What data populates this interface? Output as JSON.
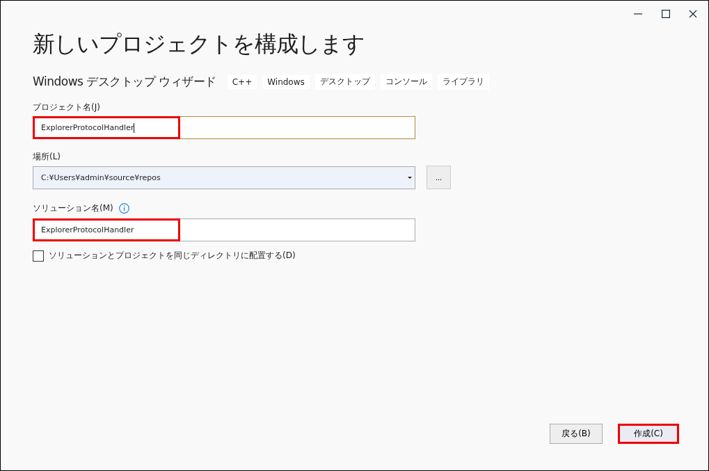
{
  "window": {
    "title": "新しいプロジェクトを構成します"
  },
  "template": {
    "name": "Windows デスクトップ ウィザード",
    "tags": [
      "C++",
      "Windows",
      "デスクトップ",
      "コンソール",
      "ライブラリ"
    ]
  },
  "project_name": {
    "label": "プロジェクト名(J)",
    "value": "ExplorerProtocolHandler",
    "highlighted": true,
    "focused": true
  },
  "location": {
    "label": "場所(L)",
    "value": "C:¥Users¥admin¥source¥repos",
    "browse": "..."
  },
  "solution_name": {
    "label": "ソリューション名(M)",
    "value": "ExplorerProtocolHandler",
    "highlighted": true
  },
  "same_directory": {
    "label": "ソリューションとプロジェクトを同じディレクトリに配置する(D)",
    "checked": false
  },
  "buttons": [
    {
      "label": "戻る(B)",
      "highlighted": false,
      "primary": false
    },
    {
      "label": "作成(C)",
      "highlighted": true,
      "primary": true
    }
  ]
}
